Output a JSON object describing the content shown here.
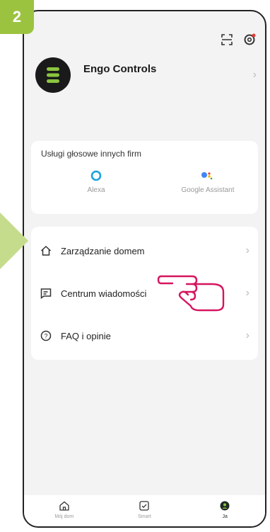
{
  "step": {
    "number": "2"
  },
  "colors": {
    "accent": "#9cc340",
    "active_tab": "#1f2a24",
    "pointer": "#d6145f"
  },
  "header": {
    "icons": [
      "scan-icon",
      "settings-icon"
    ]
  },
  "profile": {
    "name": "Engo Controls"
  },
  "voice_services": {
    "title": "Usługi głosowe innych firm",
    "items": [
      {
        "label": "Alexa",
        "icon": "alexa-icon"
      },
      {
        "label": "Google Assistant",
        "icon": "google-assistant-icon"
      }
    ]
  },
  "menu": {
    "items": [
      {
        "label": "Zarządzanie domem",
        "icon": "home-icon"
      },
      {
        "label": "Centrum wiadomości",
        "icon": "message-icon"
      },
      {
        "label": "FAQ i opinie",
        "icon": "help-icon"
      }
    ]
  },
  "bottom_nav": {
    "items": [
      {
        "label": "Mój dom",
        "icon": "home-tab-icon",
        "active": false
      },
      {
        "label": "Smart",
        "icon": "smart-tab-icon",
        "active": false
      },
      {
        "label": "Ja",
        "icon": "me-tab-icon",
        "active": true
      }
    ]
  }
}
